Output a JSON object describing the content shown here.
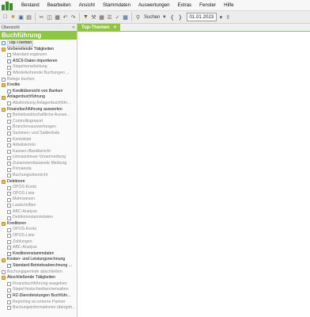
{
  "menu": [
    "Bestand",
    "Bearbeiten",
    "Ansicht",
    "Stammdaten",
    "Auswertungen",
    "Extras",
    "Fenster",
    "Hilfe"
  ],
  "toolbar": {
    "search_label": "Suchen",
    "date_value": "01.01.2023",
    "icons": [
      "new-icon",
      "open-icon",
      "save-icon",
      "print-icon",
      "cut-icon",
      "copy-icon",
      "paste-icon",
      "undo-icon",
      "redo-icon",
      "filter-icon",
      "tools-icon",
      "grid-icon",
      "list-icon",
      "check-icon",
      "chart-icon",
      "search-icon",
      "chevron-down-icon",
      "prev-icon",
      "next-icon",
      "up-icon"
    ]
  },
  "left_panel": {
    "caption": "Übersicht",
    "title": "Buchführung",
    "items": [
      {
        "label": "Top-Themen",
        "icon": "doc",
        "level": 0,
        "selected": true,
        "enabled": true
      },
      {
        "label": "Vorbereitende Tätigkeiten",
        "icon": "folder",
        "level": 0,
        "enabled": true
      },
      {
        "label": "Mandant ergänzen",
        "icon": "doc",
        "level": 1,
        "enabled": false
      },
      {
        "label": "ASCII-Daten importieren",
        "icon": "doc",
        "level": 1,
        "enabled": true
      },
      {
        "label": "Stapelverarbeitung",
        "icon": "doc",
        "level": 1,
        "enabled": false
      },
      {
        "label": "Wiederkehrende Buchungen ...",
        "icon": "doc",
        "level": 1,
        "enabled": false
      },
      {
        "label": "Belege buchen",
        "icon": "doc",
        "level": 0,
        "enabled": false
      },
      {
        "label": "Kredite",
        "icon": "folder",
        "level": 0,
        "enabled": true
      },
      {
        "label": "Kreditübersicht von Banken",
        "icon": "doc",
        "level": 1,
        "enabled": true
      },
      {
        "label": "Anlagenbuchführung",
        "icon": "folder",
        "level": 0,
        "enabled": true
      },
      {
        "label": "Abstimmung Anlagenbuchführ...",
        "icon": "doc",
        "level": 1,
        "enabled": false
      },
      {
        "label": "Finanzbuchführung auswerten",
        "icon": "folder",
        "level": 0,
        "enabled": true
      },
      {
        "label": "Betriebswirtschaftliche Auswe...",
        "icon": "doc",
        "level": 1,
        "enabled": false
      },
      {
        "label": "Controllingreport",
        "icon": "doc",
        "level": 1,
        "enabled": false
      },
      {
        "label": "Branchenauswertungen",
        "icon": "doc",
        "level": 1,
        "enabled": false
      },
      {
        "label": "Summen- und Saldenliste",
        "icon": "doc",
        "level": 1,
        "enabled": false
      },
      {
        "label": "Kontoblatt",
        "icon": "doc",
        "level": 1,
        "enabled": false
      },
      {
        "label": "Arbeitskonto",
        "icon": "doc",
        "level": 1,
        "enabled": false
      },
      {
        "label": "Kassen-/Bankbericht",
        "icon": "doc",
        "level": 1,
        "enabled": false
      },
      {
        "label": "Umsatzsteuer-Voranmeldung",
        "icon": "doc",
        "level": 1,
        "enabled": false
      },
      {
        "label": "Zusammenfassende Meldung",
        "icon": "doc",
        "level": 1,
        "enabled": false
      },
      {
        "label": "Primanota",
        "icon": "doc",
        "level": 1,
        "enabled": false
      },
      {
        "label": "Buchungsübersicht",
        "icon": "doc",
        "level": 1,
        "enabled": false
      },
      {
        "label": "Debitoren",
        "icon": "folder",
        "level": 0,
        "enabled": true
      },
      {
        "label": "OPOS-Konto",
        "icon": "doc",
        "level": 1,
        "enabled": false
      },
      {
        "label": "OPOS-Liste",
        "icon": "doc",
        "level": 1,
        "enabled": false
      },
      {
        "label": "Mahnwesen",
        "icon": "doc",
        "level": 1,
        "enabled": false
      },
      {
        "label": "Lastschriften",
        "icon": "doc",
        "level": 1,
        "enabled": false
      },
      {
        "label": "ABC-Analyse",
        "icon": "doc",
        "level": 1,
        "enabled": false
      },
      {
        "label": "Debitorenstammdaten",
        "icon": "doc",
        "level": 1,
        "enabled": false
      },
      {
        "label": "Kreditoren",
        "icon": "folder",
        "level": 0,
        "enabled": true
      },
      {
        "label": "OPOS-Konto",
        "icon": "doc",
        "level": 1,
        "enabled": false
      },
      {
        "label": "OPOS-Liste",
        "icon": "doc",
        "level": 1,
        "enabled": false
      },
      {
        "label": "Zahlungen",
        "icon": "doc",
        "level": 1,
        "enabled": false
      },
      {
        "label": "ABC-Analyse",
        "icon": "doc",
        "level": 1,
        "enabled": false
      },
      {
        "label": "Kreditorenstammdaten",
        "icon": "doc",
        "level": 1,
        "enabled": true
      },
      {
        "label": "Kosten- und Leistungsrechnung",
        "icon": "folder",
        "level": 0,
        "enabled": true
      },
      {
        "label": "Standard-Betriebsabrechnung ...",
        "icon": "doc",
        "level": 1,
        "enabled": true
      },
      {
        "label": "Buchungsperiode abschließen",
        "icon": "doc",
        "level": 0,
        "enabled": false
      },
      {
        "label": "Abschließende Tätigkeiten",
        "icon": "folder",
        "level": 0,
        "enabled": true
      },
      {
        "label": "Finanzbuchführung ausgeben",
        "icon": "doc",
        "level": 1,
        "enabled": false
      },
      {
        "label": "Stapel festschreiben/verwalten",
        "icon": "doc",
        "level": 1,
        "enabled": false
      },
      {
        "label": "RZ-Dienstleistungen Buchführ...",
        "icon": "doc",
        "level": 1,
        "enabled": true
      },
      {
        "label": "Reporting an externe Partner",
        "icon": "doc",
        "level": 1,
        "enabled": false
      },
      {
        "label": "Buchungsinformationen übergeb...",
        "icon": "doc",
        "level": 1,
        "enabled": false
      }
    ]
  },
  "main": {
    "tab_label": "Top-Themen",
    "tab_close": "×"
  },
  "colors": {
    "accent": "#8dc63f",
    "folder": "#e8c25a"
  }
}
